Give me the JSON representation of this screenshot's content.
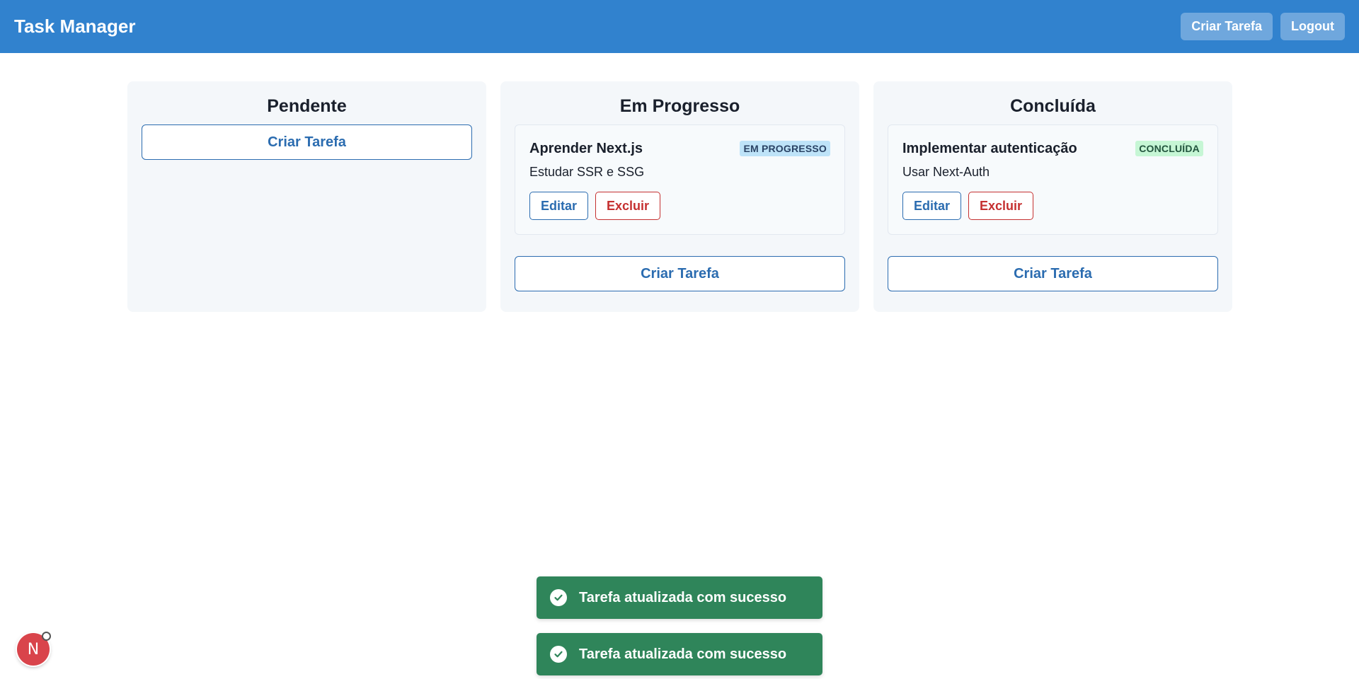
{
  "app": {
    "title": "Task Manager"
  },
  "header": {
    "create_label": "Criar Tarefa",
    "logout_label": "Logout"
  },
  "columns": [
    {
      "title": "Pendente",
      "create_label": "Criar Tarefa",
      "tasks": []
    },
    {
      "title": "Em Progresso",
      "create_label": "Criar Tarefa",
      "tasks": [
        {
          "title": "Aprender Next.js",
          "status": "EM PROGRESSO",
          "description": "Estudar SSR e SSG",
          "edit_label": "Editar",
          "delete_label": "Excluir"
        }
      ]
    },
    {
      "title": "Concluída",
      "create_label": "Criar Tarefa",
      "tasks": [
        {
          "title": "Implementar autenticação",
          "status": "CONCLUÍDA",
          "description": "Usar Next-Auth",
          "edit_label": "Editar",
          "delete_label": "Excluir"
        }
      ]
    }
  ],
  "toasts": [
    {
      "message": "Tarefa atualizada com sucesso",
      "icon": "check-circle-icon"
    },
    {
      "message": "Tarefa atualizada com sucesso",
      "icon": "check-circle-icon"
    }
  ],
  "dev_badge": {
    "letter": "N"
  },
  "colors": {
    "primary": "#3182ce",
    "accent_blue": "#2b6cb0",
    "danger": "#c53030",
    "success": "#2f855a",
    "column_bg": "#f4f7fa"
  }
}
